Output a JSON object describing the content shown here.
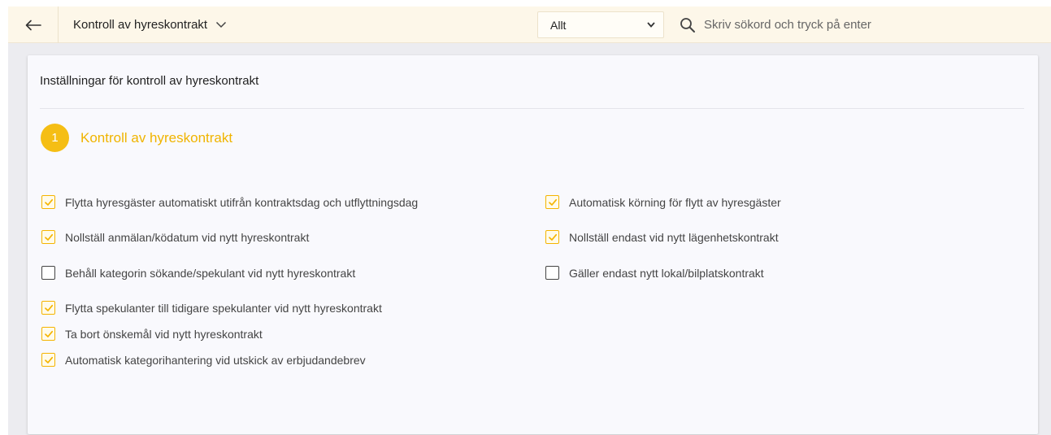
{
  "header": {
    "title": "Kontroll av hyreskontrakt",
    "filter_value": "Allt",
    "search_placeholder": "Skriv sökord och tryck på enter"
  },
  "card": {
    "title": "Inställningar för kontroll av hyreskontrakt",
    "step_number": "1",
    "step_label": "Kontroll av hyreskontrakt"
  },
  "options_left": [
    {
      "label": "Flytta hyresgäster automatiskt utifrån kontraktsdag och utflyttningsdag",
      "checked": true
    },
    {
      "label": "Nollställ anmälan/ködatum vid nytt hyreskontrakt",
      "checked": true
    },
    {
      "label": "Behåll kategorin sökande/spekulant vid nytt hyreskontrakt",
      "checked": false
    },
    {
      "label": "Flytta spekulanter till tidigare spekulanter vid nytt hyreskontrakt",
      "checked": true
    },
    {
      "label": "Ta bort önskemål vid nytt hyreskontrakt",
      "checked": true
    },
    {
      "label": "Automatisk kategorihantering vid utskick av erbjudandebrev",
      "checked": true
    }
  ],
  "options_right": [
    {
      "label": "Automatisk körning för flytt av hyresgäster",
      "checked": true
    },
    {
      "label": "Nollställ endast vid nytt lägenhetskontrakt",
      "checked": true
    },
    {
      "label": "Gäller endast nytt lokal/bilplatskontrakt",
      "checked": false
    }
  ],
  "colors": {
    "accent": "#f5be14",
    "header_bg": "#fdf7e9",
    "card_bg": "#f9f9fd"
  }
}
